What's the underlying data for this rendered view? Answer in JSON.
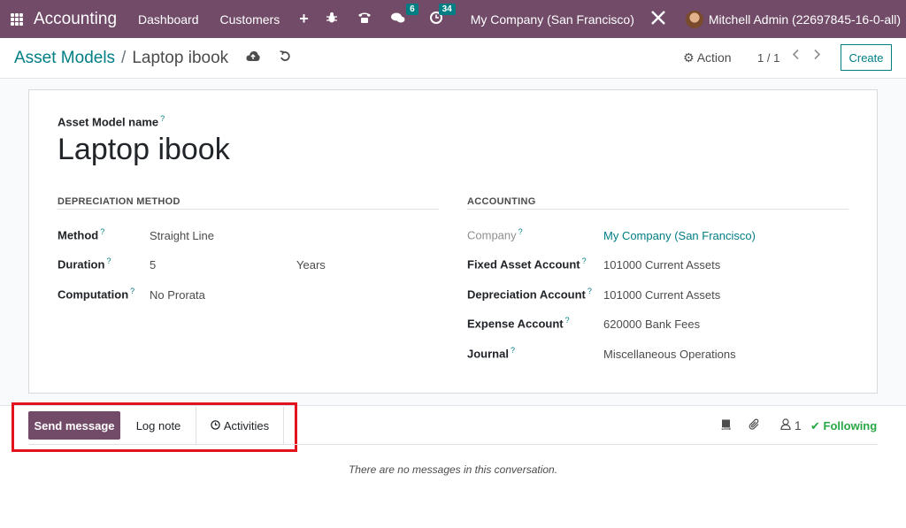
{
  "navbar": {
    "brand": "Accounting",
    "menu": [
      "Dashboard",
      "Customers"
    ],
    "plus": "+",
    "messages_badge": "6",
    "activities_badge": "34",
    "company": "My Company (San Francisco)",
    "user": "Mitchell Admin (22697845-16-0-all)",
    "icons": [
      "apps-icon",
      "bug-icon",
      "phone-icon",
      "messages-icon",
      "clock-icon",
      "tools-icon"
    ]
  },
  "control": {
    "breadcrumb_parent": "Asset Models",
    "breadcrumb_sep": "/",
    "breadcrumb_current": "Laptop ibook",
    "action_label": "Action",
    "pager": "1 / 1",
    "create_label": "Create"
  },
  "form": {
    "name_label": "Asset Model name",
    "help_mark": "?",
    "name_value": "Laptop ibook",
    "depreciation": {
      "title": "DEPRECIATION METHOD",
      "method_label": "Method",
      "method_value": "Straight Line",
      "duration_label": "Duration",
      "duration_value": "5",
      "duration_unit": "Years",
      "computation_label": "Computation",
      "computation_value": "No Prorata"
    },
    "accounting": {
      "title": "ACCOUNTING",
      "company_label": "Company",
      "company_value": "My Company (San Francisco)",
      "fixed_label": "Fixed Asset Account",
      "fixed_value": "101000 Current Assets",
      "depr_label": "Depreciation Account",
      "depr_value": "101000 Current Assets",
      "expense_label": "Expense Account",
      "expense_value": "620000 Bank Fees",
      "journal_label": "Journal",
      "journal_value": "Miscellaneous Operations"
    }
  },
  "chatter": {
    "send_label": "Send message",
    "log_label": "Log note",
    "activities_label": "Activities",
    "followers_count": "1",
    "following_label": "Following",
    "empty_message": "There are no messages in this conversation."
  },
  "colors": {
    "brand": "#714b67",
    "accent": "#017e84",
    "highlight": "#e3131e",
    "following": "#28a745"
  }
}
